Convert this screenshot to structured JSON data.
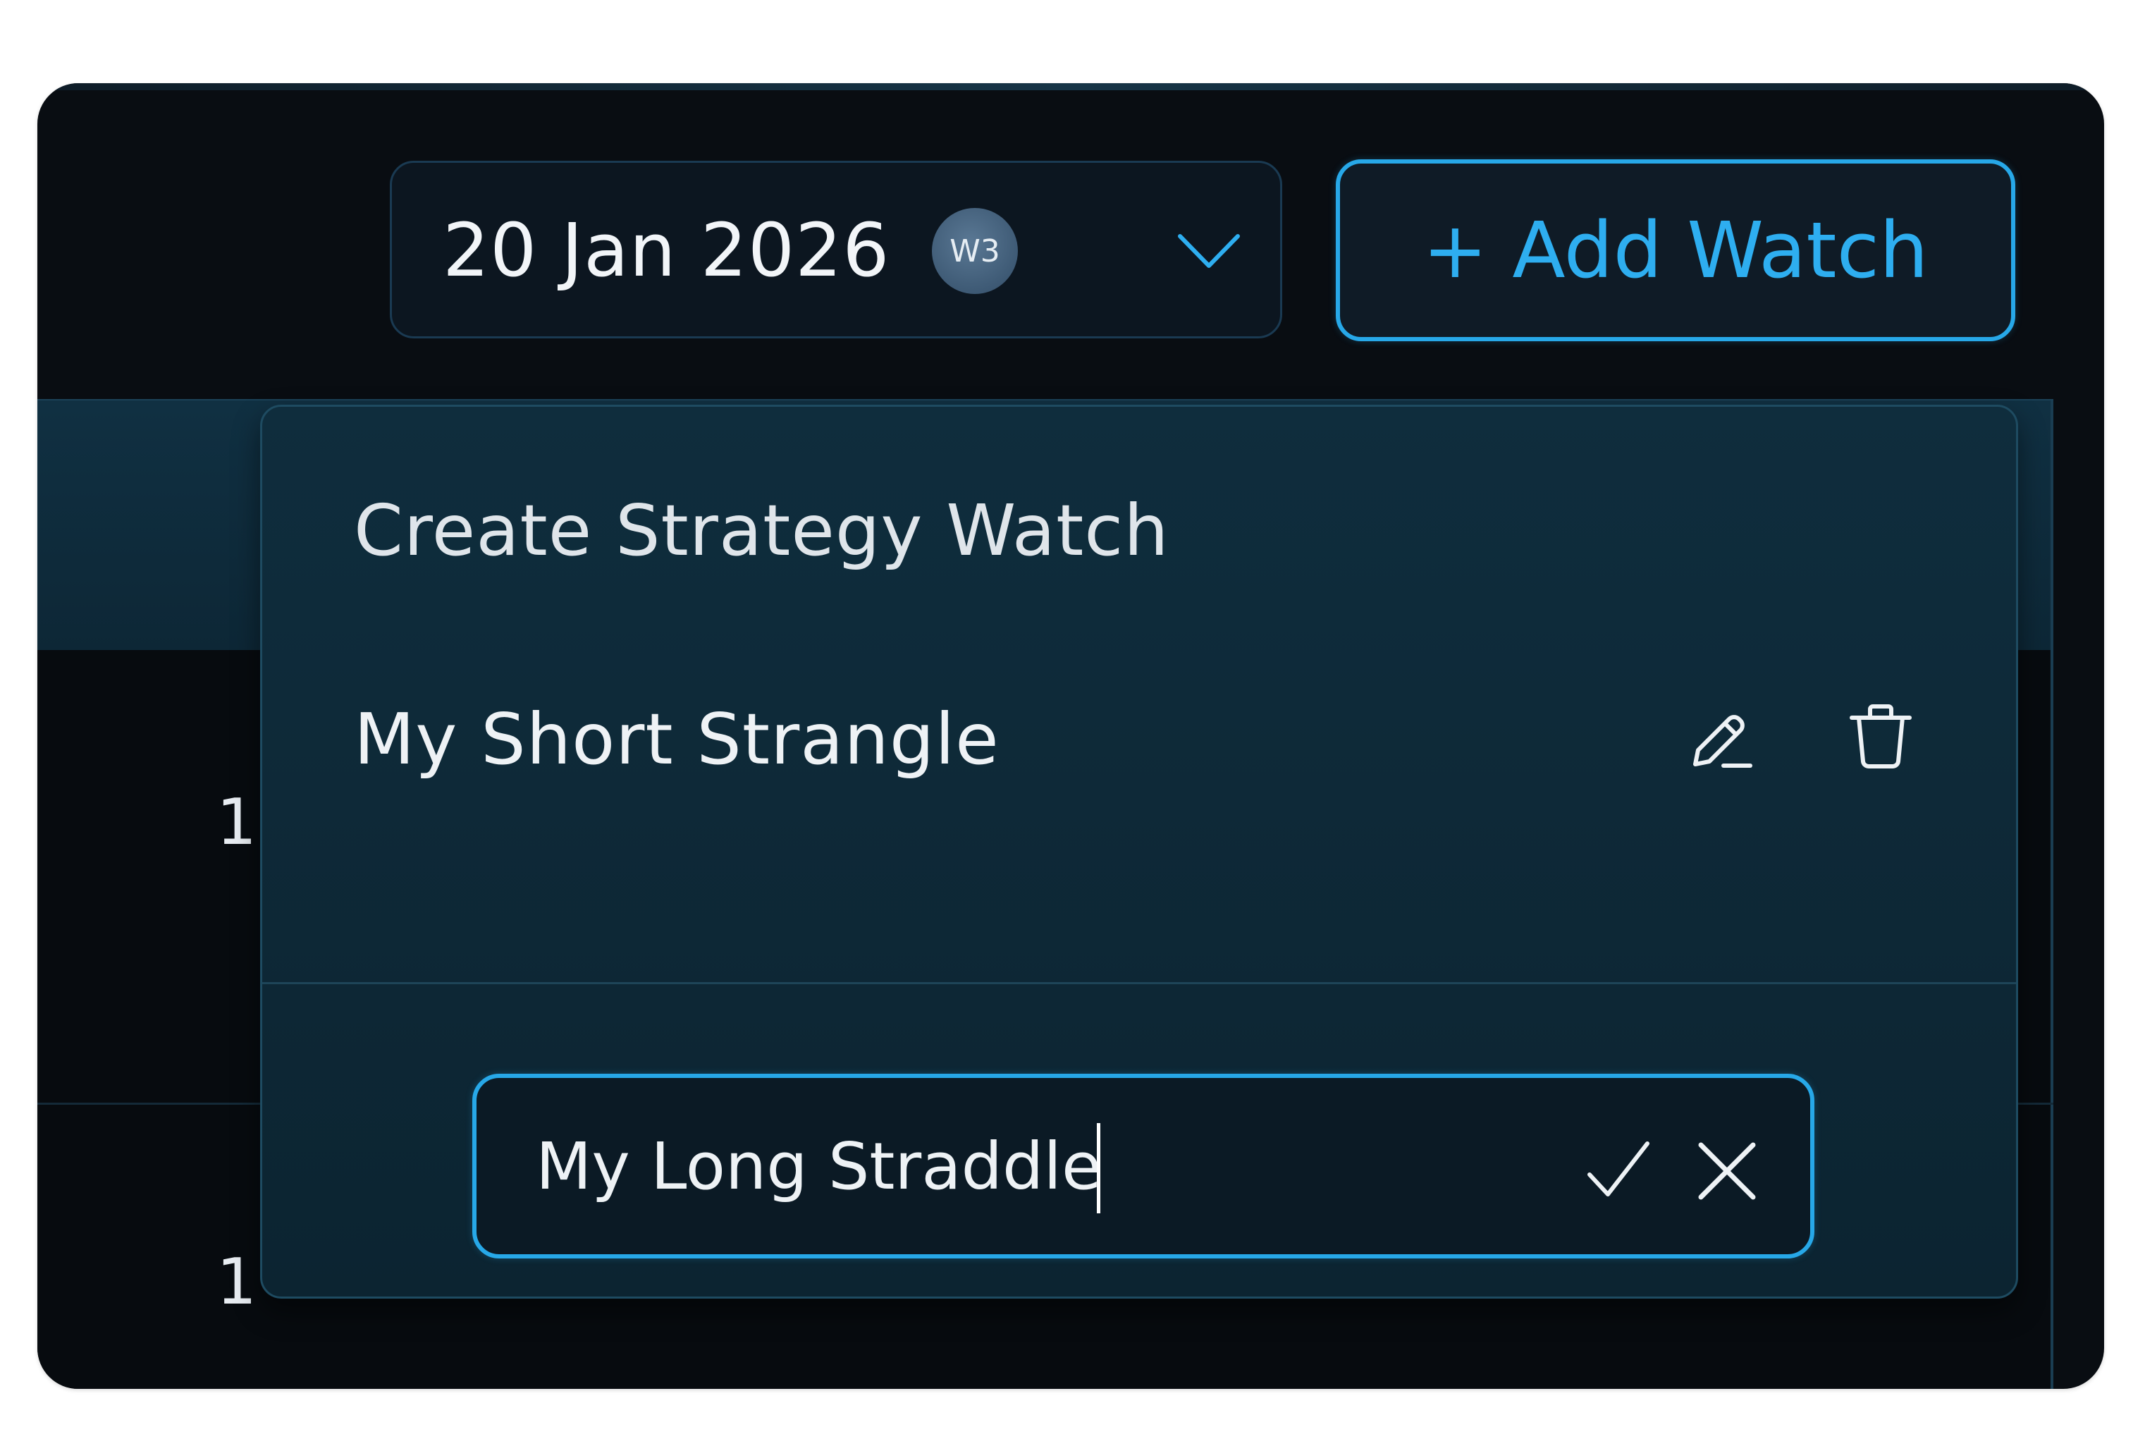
{
  "toolbar": {
    "date_select": {
      "value": "20 Jan 2026",
      "badge": "W3",
      "chevron_icon": "chevron-down-icon"
    },
    "add_watch_label": "+ Add Watch"
  },
  "table": {
    "rows": [
      {
        "number": "1"
      },
      {
        "number": "1"
      }
    ]
  },
  "popover": {
    "title": "Create Strategy Watch",
    "strategies": [
      {
        "name": "My Short Strangle",
        "edit_icon": "pencil-icon",
        "delete_icon": "trash-icon"
      }
    ],
    "new_name_field": {
      "value": "My Long Straddle",
      "confirm_icon": "check-icon",
      "cancel_icon": "close-icon"
    }
  },
  "colors": {
    "accent": "#27a8e8",
    "background": "#090d12",
    "popover_bg": "#0f2d3d",
    "badge_bg": "#4a6884"
  }
}
